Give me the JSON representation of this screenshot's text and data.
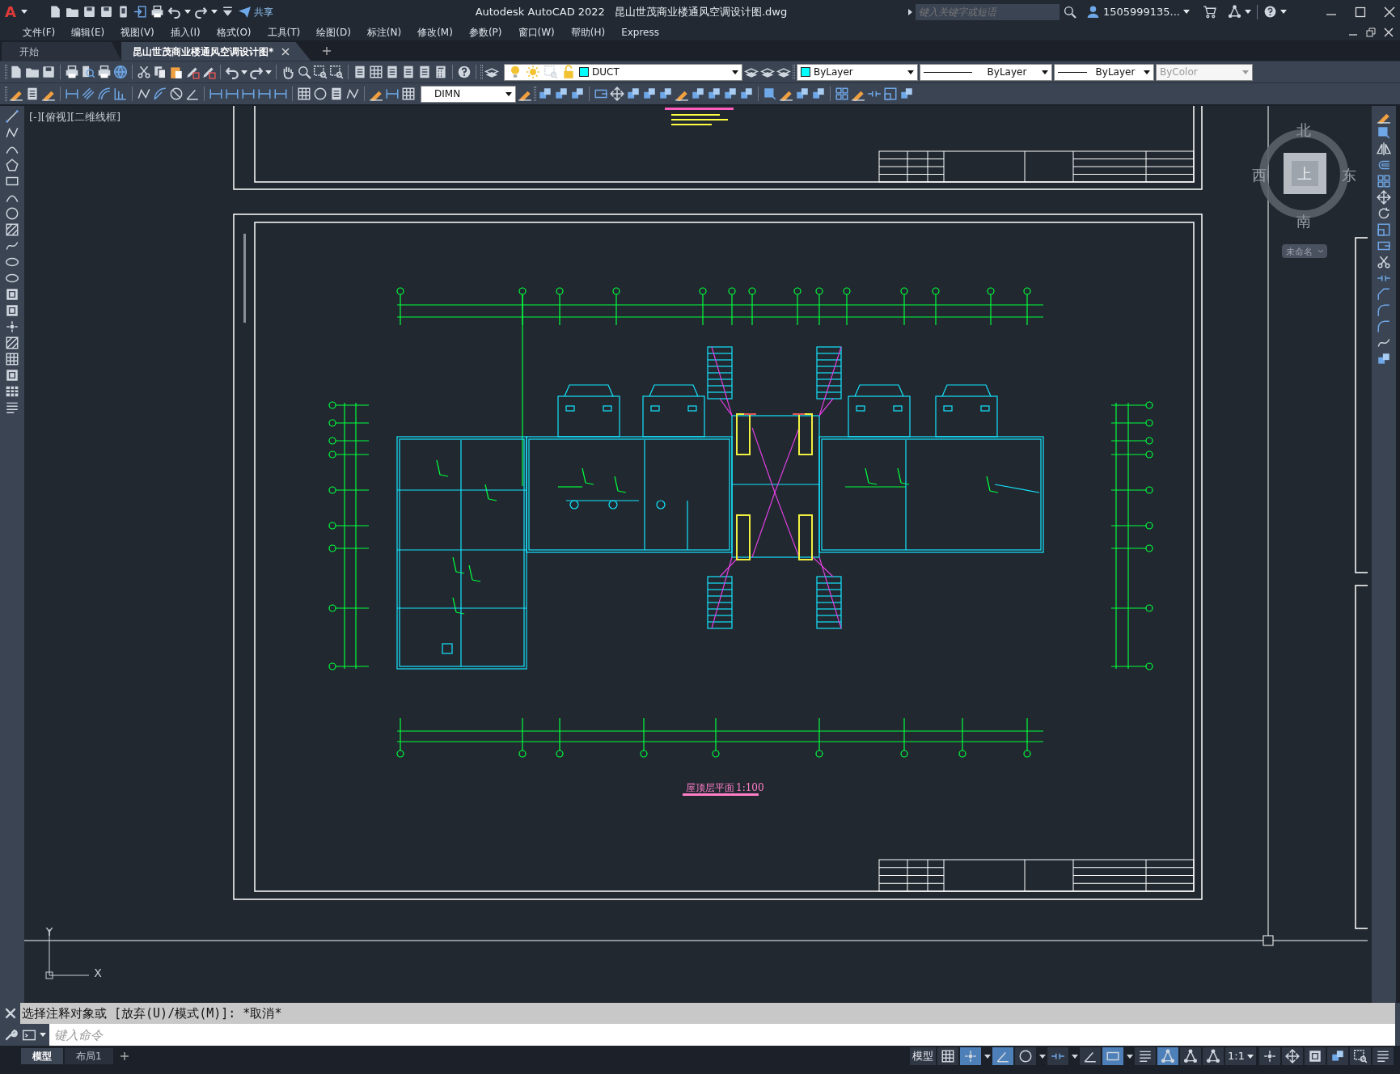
{
  "app": {
    "logo": "A",
    "title": "Autodesk AutoCAD 2022",
    "document": "昆山世茂商业楼通风空调设计图.dwg",
    "share": "共享",
    "search": {
      "placeholder": "键入关键字或短语"
    },
    "user": "1505999135..."
  },
  "menu": [
    "文件(F)",
    "编辑(E)",
    "视图(V)",
    "插入(I)",
    "格式(O)",
    "工具(T)",
    "绘图(D)",
    "标注(N)",
    "修改(M)",
    "参数(P)",
    "窗口(W)",
    "帮助(H)",
    "Express"
  ],
  "file_tabs": [
    {
      "label": "开始",
      "selected": false
    },
    {
      "label": "昆山世茂商业楼通风空调设计图*",
      "selected": true
    }
  ],
  "toolbar": {
    "layer": "DUCT",
    "color_control": "ByLayer",
    "linetype": "ByLayer",
    "lineweight": "ByLayer",
    "plot_style": {
      "value": "ByColor",
      "disabled": true
    },
    "dim_style": "DIMN"
  },
  "viewport": {
    "label": "[-][俯视][二维线框]",
    "viewcube": {
      "north": "北",
      "south": "南",
      "east": "东",
      "west": "西",
      "face": "上",
      "view_name": "未命名"
    },
    "plan_title": "屋顶层平面",
    "plan_scale": "1:100",
    "ucs": {
      "x": "X",
      "y": "Y"
    }
  },
  "command": {
    "history": "选择注释对象或 [放弃(U)/模式(M)]: *取消*",
    "placeholder": "键入命令"
  },
  "layout_tabs": [
    {
      "label": "模型",
      "selected": true
    },
    {
      "label": "布局1",
      "selected": false
    }
  ],
  "status_bar": {
    "space": "模型",
    "toggles": [
      {
        "kind": "grid",
        "on": false,
        "menu": false
      },
      {
        "kind": "snap",
        "on": true,
        "menu": true
      },
      {
        "kind": "ortho",
        "on": true,
        "menu": false
      },
      {
        "kind": "polar",
        "on": false,
        "menu": true
      },
      {
        "kind": "isodraft",
        "on": false,
        "menu": true
      },
      {
        "kind": "angle",
        "on": false,
        "menu": false
      },
      {
        "kind": "osnap",
        "on": true,
        "menu": true
      },
      {
        "kind": "lineweight",
        "on": false,
        "menu": false
      },
      {
        "kind": "annovis",
        "on": true,
        "menu": false
      },
      {
        "kind": "autoscale",
        "on": false,
        "menu": false
      },
      {
        "kind": "annoscale",
        "on": false,
        "menu": false
      }
    ],
    "scale": "1:1"
  }
}
